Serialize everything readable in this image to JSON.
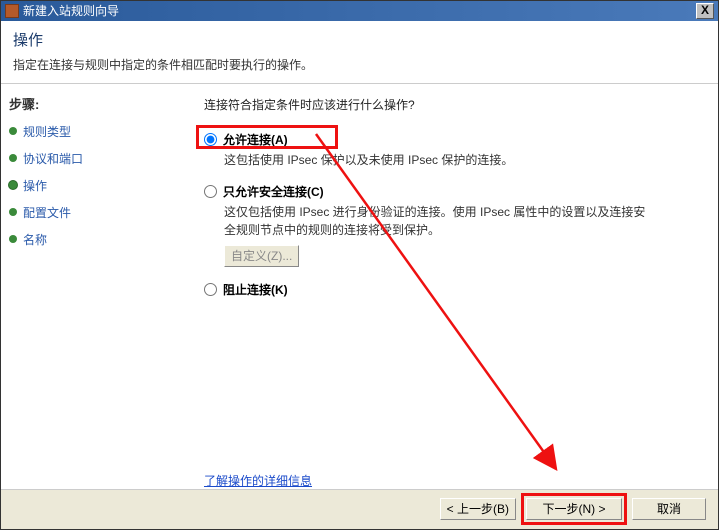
{
  "window": {
    "title": "新建入站规则向导",
    "close": "X"
  },
  "header": {
    "title": "操作",
    "desc": "指定在连接与规则中指定的条件相匹配时要执行的操作。"
  },
  "sidebar": {
    "title": "步骤:",
    "steps": [
      {
        "label": "规则类型"
      },
      {
        "label": "协议和端口"
      },
      {
        "label": "操作"
      },
      {
        "label": "配置文件"
      },
      {
        "label": "名称"
      }
    ]
  },
  "content": {
    "question": "连接符合指定条件时应该进行什么操作?",
    "options": {
      "allow": {
        "label": "允许连接(A)",
        "desc": "这包括使用 IPsec 保护以及未使用 IPsec 保护的连接。"
      },
      "secure": {
        "label": "只允许安全连接(C)",
        "desc": "这仅包括使用 IPsec 进行身份验证的连接。使用 IPsec 属性中的设置以及连接安全规则节点中的规则的连接将受到保护。"
      },
      "block": {
        "label": "阻止连接(K)"
      }
    },
    "customize_btn": "自定义(Z)...",
    "learn_more": "了解操作的详细信息"
  },
  "footer": {
    "back": "< 上一步(B)",
    "next": "下一步(N) >",
    "cancel": "取消"
  }
}
